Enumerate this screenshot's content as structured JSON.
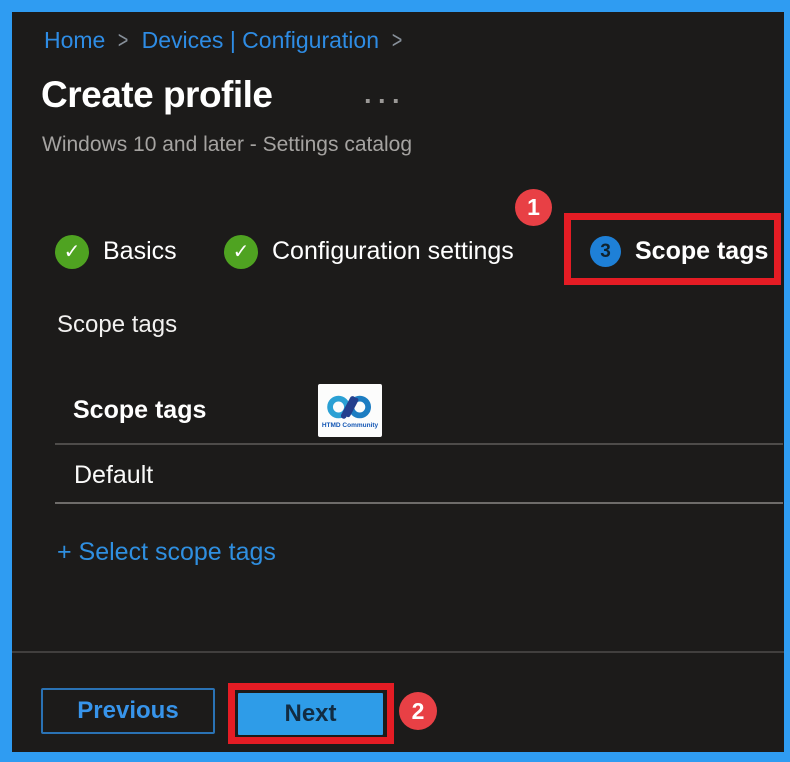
{
  "window": {
    "frame_color": "#2f9cf2",
    "background": "#1c1b1a"
  },
  "breadcrumb": {
    "separator": ">",
    "items": [
      {
        "label": "Home"
      },
      {
        "label": "Devices | Configuration"
      }
    ]
  },
  "header": {
    "title": "Create profile",
    "more_label": "···",
    "subtitle": "Windows 10 and later - Settings catalog"
  },
  "wizard": {
    "steps": [
      {
        "label": "Basics",
        "status": "completed",
        "icon": "✓"
      },
      {
        "label": "Configuration settings",
        "status": "completed",
        "icon": "✓"
      },
      {
        "label": "Scope tags",
        "status": "current",
        "number": "3"
      }
    ]
  },
  "content": {
    "section_label": "Scope tags",
    "table": {
      "header": "Scope tags",
      "rows": [
        {
          "value": "Default"
        }
      ]
    },
    "select_link": "+ Select scope tags"
  },
  "watermark": {
    "text": "HTMD Community"
  },
  "footer": {
    "previous_label": "Previous",
    "next_label": "Next"
  },
  "annotations": {
    "callout_1": "1",
    "callout_2": "2",
    "highlight_color": "#e41c24"
  },
  "colors": {
    "accent_blue": "#2e9ce8",
    "link_blue": "#2f8fe0",
    "breadcrumb_blue": "#2e8ce4",
    "step_complete_green": "#4fa321",
    "step_current_blue": "#1e80d7",
    "annotation_red": "#e84045",
    "subtitle_gray": "#a5a3a1"
  }
}
